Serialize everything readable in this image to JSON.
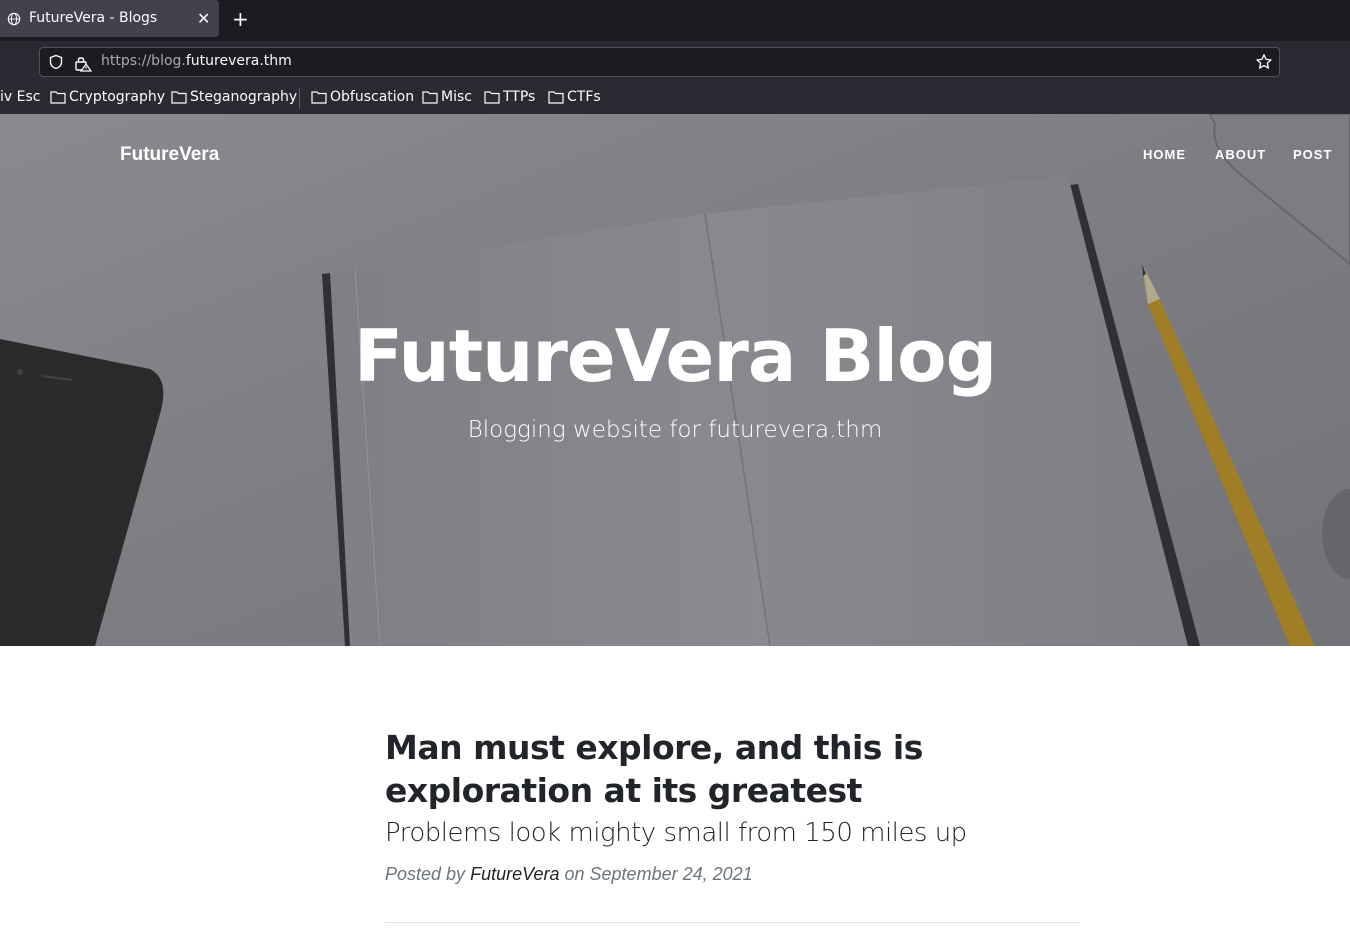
{
  "browser": {
    "tab_title": "FutureVera - Blogs",
    "url_scheme_sub": "https://blog.",
    "url_domain": "futurevera.thm",
    "bookmarks": [
      "iv Esc",
      "Cryptography",
      "Steganography",
      "Obfuscation",
      "Misc",
      "TTPs",
      "CTFs"
    ]
  },
  "site": {
    "brand": "FutureVera",
    "nav": [
      "HOME",
      "ABOUT",
      "POST"
    ],
    "hero_title": "FutureVera Blog",
    "hero_subtitle": "Blogging website for futurevera.thm"
  },
  "post": {
    "title": "Man must explore, and this is exploration at its greatest",
    "subtitle": "Problems look mighty small from 150 miles up",
    "meta_prefix": "Posted by",
    "author": "FutureVera",
    "meta_on": "on",
    "date": "September 24, 2021"
  }
}
